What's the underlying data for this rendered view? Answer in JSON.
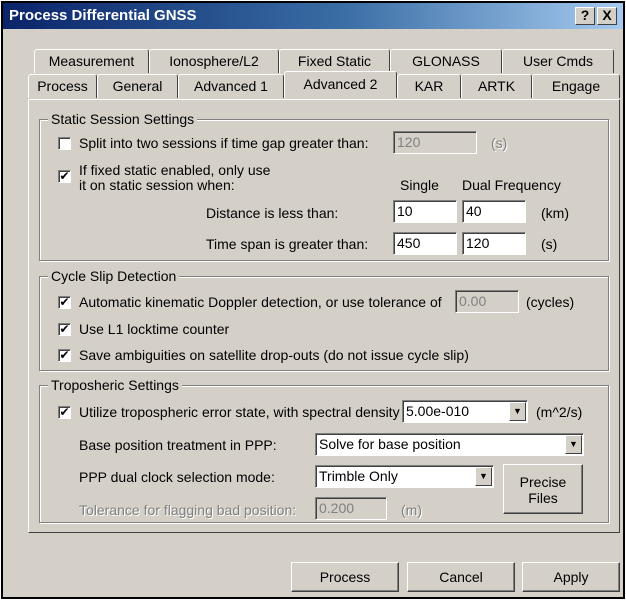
{
  "window": {
    "title": "Process Differential GNSS",
    "help_label": "?",
    "close_label": "X"
  },
  "tabs": {
    "row1": [
      "Measurement",
      "Ionosphere/L2",
      "Fixed Static",
      "GLONASS",
      "User Cmds"
    ],
    "row2": [
      "Process",
      "General",
      "Advanced 1",
      "Advanced 2",
      "KAR",
      "ARTK",
      "Engage"
    ],
    "active": "Advanced 2"
  },
  "static_session": {
    "legend": "Static Session Settings",
    "split_label": "Split into two sessions if time gap greater than:",
    "split_checked": false,
    "split_value": "120",
    "split_unit": "(s)",
    "fixed_label_line1": "If fixed static enabled, only use",
    "fixed_label_line2": "it on static session when:",
    "fixed_checked": true,
    "col_single": "Single",
    "col_dual": "Dual Frequency",
    "distance_label": "Distance is less than:",
    "distance_single": "10",
    "distance_dual": "40",
    "distance_unit": "(km)",
    "timespan_label": "Time span is greater than:",
    "timespan_single": "450",
    "timespan_dual": "120",
    "timespan_unit": "(s)"
  },
  "cycle_slip": {
    "legend": "Cycle Slip Detection",
    "doppler_label": "Automatic kinematic Doppler detection, or use tolerance of",
    "doppler_checked": true,
    "doppler_value": "0.00",
    "doppler_unit": "(cycles)",
    "locktime_label": "Use L1 locktime counter",
    "locktime_checked": true,
    "save_label": "Save ambiguities on satellite drop-outs (do not issue cycle slip)",
    "save_checked": true
  },
  "tropospheric": {
    "legend": "Troposheric Settings",
    "utilize_label": "Utilize tropospheric error state, with spectral density",
    "utilize_checked": true,
    "density_value": "5.00e-010",
    "density_unit": "(m^2/s)",
    "base_label": "Base position treatment in PPP:",
    "base_value": "Solve for base position",
    "clock_label": "PPP dual clock selection mode:",
    "clock_value": "Trimble Only",
    "tolerance_label": "Tolerance for flagging bad position:",
    "tolerance_value": "0.200",
    "tolerance_unit": "(m)",
    "precise_line1": "Precise",
    "precise_line2": "Files"
  },
  "footer": {
    "process": "Process",
    "cancel": "Cancel",
    "apply": "Apply"
  }
}
